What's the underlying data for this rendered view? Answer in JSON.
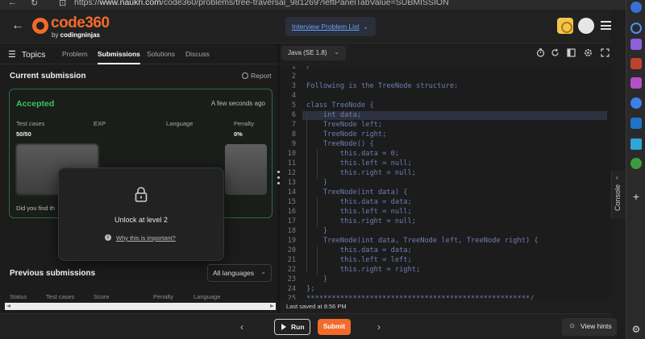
{
  "browser": {
    "url_prefix": "https://",
    "url_domain": "www.naukri.com",
    "url_path": "/code360/problems/tree-traversal_981269?leftPanelTabValue=SUBMISSION"
  },
  "header": {
    "logo_text": "code360",
    "logo_sub_prefix": "by ",
    "logo_sub_brand": "codingninjas",
    "problem_list_label": "Interview Problem List",
    "accent": "#f36b2b"
  },
  "left_panel": {
    "topics_label": "Topics",
    "tabs": [
      {
        "label": "Problem"
      },
      {
        "label": "Submissions"
      },
      {
        "label": "Solutions"
      },
      {
        "label": "Discuss"
      }
    ],
    "active_tab": "Submissions",
    "current_submission_title": "Current submission",
    "report_label": "Report",
    "submission": {
      "status": "Accepted",
      "status_color": "#3cc465",
      "time": "A few seconds ago",
      "col_test_cases": "Test cases",
      "col_exp": "EXP",
      "col_language": "Language",
      "col_penalty": "Penalty",
      "test_cases_value": "50/50",
      "penalty_value": "0%",
      "feedback_prefix": "Did you find th"
    },
    "lock_popup": {
      "title": "Unlock at level 2",
      "link": "Why this is important?"
    },
    "previous_title": "Previous submissions",
    "language_filter": "All languages",
    "prev_headers": [
      "Status",
      "Test cases",
      "Score",
      "Penalty",
      "Language"
    ]
  },
  "editor": {
    "language": "Java (SE 1.8)",
    "lines": [
      "/*****************************************************",
      "",
      "Following is the TreeNode structure:",
      "",
      "class TreeNode {",
      "    int data;",
      "    TreeNode left;",
      "    TreeNode right;",
      "    TreeNode() {",
      "        this.data = 0;",
      "        this.left = null;",
      "        this.right = null;",
      "    }",
      "    TreeNode(int data) {",
      "        this.data = data;",
      "        this.left = null;",
      "        this.right = null;",
      "    }",
      "    TreeNode(int data, TreeNode left, TreeNode right) {",
      "        this.data = data;",
      "        this.left = left;",
      "        this.right = right;",
      "    }",
      "};",
      "*****************************************************/"
    ],
    "highlighted_line": 6,
    "last_saved": "Last saved at 8:56 PM"
  },
  "bottom_bar": {
    "run_label": "Run",
    "submit_label": "Submit",
    "hints_label": "View hints"
  },
  "sidebar": {
    "console_label": "Console"
  }
}
